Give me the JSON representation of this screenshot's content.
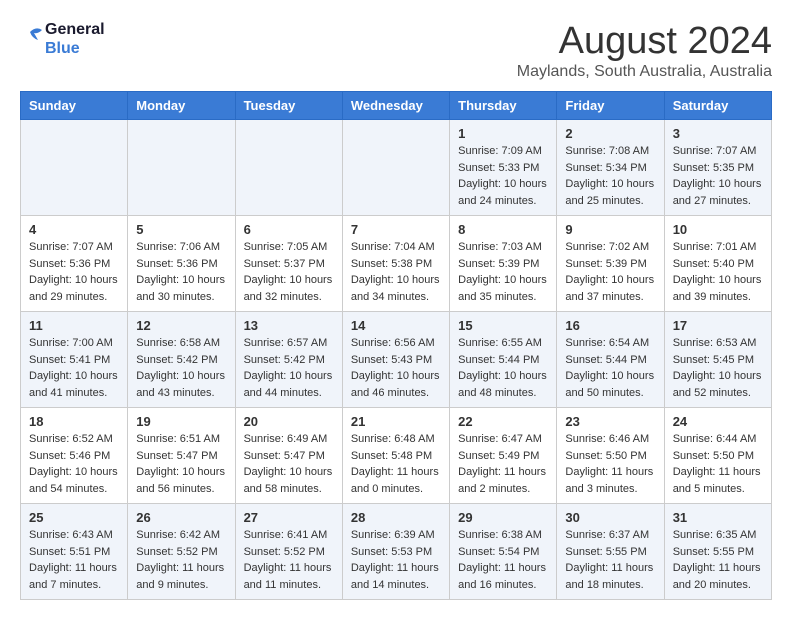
{
  "header": {
    "logo_line1": "General",
    "logo_line2": "Blue",
    "month_year": "August 2024",
    "location": "Maylands, South Australia, Australia"
  },
  "days_of_week": [
    "Sunday",
    "Monday",
    "Tuesday",
    "Wednesday",
    "Thursday",
    "Friday",
    "Saturday"
  ],
  "weeks": [
    [
      {
        "day": "",
        "info": ""
      },
      {
        "day": "",
        "info": ""
      },
      {
        "day": "",
        "info": ""
      },
      {
        "day": "",
        "info": ""
      },
      {
        "day": "1",
        "info": "Sunrise: 7:09 AM\nSunset: 5:33 PM\nDaylight: 10 hours\nand 24 minutes."
      },
      {
        "day": "2",
        "info": "Sunrise: 7:08 AM\nSunset: 5:34 PM\nDaylight: 10 hours\nand 25 minutes."
      },
      {
        "day": "3",
        "info": "Sunrise: 7:07 AM\nSunset: 5:35 PM\nDaylight: 10 hours\nand 27 minutes."
      }
    ],
    [
      {
        "day": "4",
        "info": "Sunrise: 7:07 AM\nSunset: 5:36 PM\nDaylight: 10 hours\nand 29 minutes."
      },
      {
        "day": "5",
        "info": "Sunrise: 7:06 AM\nSunset: 5:36 PM\nDaylight: 10 hours\nand 30 minutes."
      },
      {
        "day": "6",
        "info": "Sunrise: 7:05 AM\nSunset: 5:37 PM\nDaylight: 10 hours\nand 32 minutes."
      },
      {
        "day": "7",
        "info": "Sunrise: 7:04 AM\nSunset: 5:38 PM\nDaylight: 10 hours\nand 34 minutes."
      },
      {
        "day": "8",
        "info": "Sunrise: 7:03 AM\nSunset: 5:39 PM\nDaylight: 10 hours\nand 35 minutes."
      },
      {
        "day": "9",
        "info": "Sunrise: 7:02 AM\nSunset: 5:39 PM\nDaylight: 10 hours\nand 37 minutes."
      },
      {
        "day": "10",
        "info": "Sunrise: 7:01 AM\nSunset: 5:40 PM\nDaylight: 10 hours\nand 39 minutes."
      }
    ],
    [
      {
        "day": "11",
        "info": "Sunrise: 7:00 AM\nSunset: 5:41 PM\nDaylight: 10 hours\nand 41 minutes."
      },
      {
        "day": "12",
        "info": "Sunrise: 6:58 AM\nSunset: 5:42 PM\nDaylight: 10 hours\nand 43 minutes."
      },
      {
        "day": "13",
        "info": "Sunrise: 6:57 AM\nSunset: 5:42 PM\nDaylight: 10 hours\nand 44 minutes."
      },
      {
        "day": "14",
        "info": "Sunrise: 6:56 AM\nSunset: 5:43 PM\nDaylight: 10 hours\nand 46 minutes."
      },
      {
        "day": "15",
        "info": "Sunrise: 6:55 AM\nSunset: 5:44 PM\nDaylight: 10 hours\nand 48 minutes."
      },
      {
        "day": "16",
        "info": "Sunrise: 6:54 AM\nSunset: 5:44 PM\nDaylight: 10 hours\nand 50 minutes."
      },
      {
        "day": "17",
        "info": "Sunrise: 6:53 AM\nSunset: 5:45 PM\nDaylight: 10 hours\nand 52 minutes."
      }
    ],
    [
      {
        "day": "18",
        "info": "Sunrise: 6:52 AM\nSunset: 5:46 PM\nDaylight: 10 hours\nand 54 minutes."
      },
      {
        "day": "19",
        "info": "Sunrise: 6:51 AM\nSunset: 5:47 PM\nDaylight: 10 hours\nand 56 minutes."
      },
      {
        "day": "20",
        "info": "Sunrise: 6:49 AM\nSunset: 5:47 PM\nDaylight: 10 hours\nand 58 minutes."
      },
      {
        "day": "21",
        "info": "Sunrise: 6:48 AM\nSunset: 5:48 PM\nDaylight: 11 hours\nand 0 minutes."
      },
      {
        "day": "22",
        "info": "Sunrise: 6:47 AM\nSunset: 5:49 PM\nDaylight: 11 hours\nand 2 minutes."
      },
      {
        "day": "23",
        "info": "Sunrise: 6:46 AM\nSunset: 5:50 PM\nDaylight: 11 hours\nand 3 minutes."
      },
      {
        "day": "24",
        "info": "Sunrise: 6:44 AM\nSunset: 5:50 PM\nDaylight: 11 hours\nand 5 minutes."
      }
    ],
    [
      {
        "day": "25",
        "info": "Sunrise: 6:43 AM\nSunset: 5:51 PM\nDaylight: 11 hours\nand 7 minutes."
      },
      {
        "day": "26",
        "info": "Sunrise: 6:42 AM\nSunset: 5:52 PM\nDaylight: 11 hours\nand 9 minutes."
      },
      {
        "day": "27",
        "info": "Sunrise: 6:41 AM\nSunset: 5:52 PM\nDaylight: 11 hours\nand 11 minutes."
      },
      {
        "day": "28",
        "info": "Sunrise: 6:39 AM\nSunset: 5:53 PM\nDaylight: 11 hours\nand 14 minutes."
      },
      {
        "day": "29",
        "info": "Sunrise: 6:38 AM\nSunset: 5:54 PM\nDaylight: 11 hours\nand 16 minutes."
      },
      {
        "day": "30",
        "info": "Sunrise: 6:37 AM\nSunset: 5:55 PM\nDaylight: 11 hours\nand 18 minutes."
      },
      {
        "day": "31",
        "info": "Sunrise: 6:35 AM\nSunset: 5:55 PM\nDaylight: 11 hours\nand 20 minutes."
      }
    ]
  ]
}
